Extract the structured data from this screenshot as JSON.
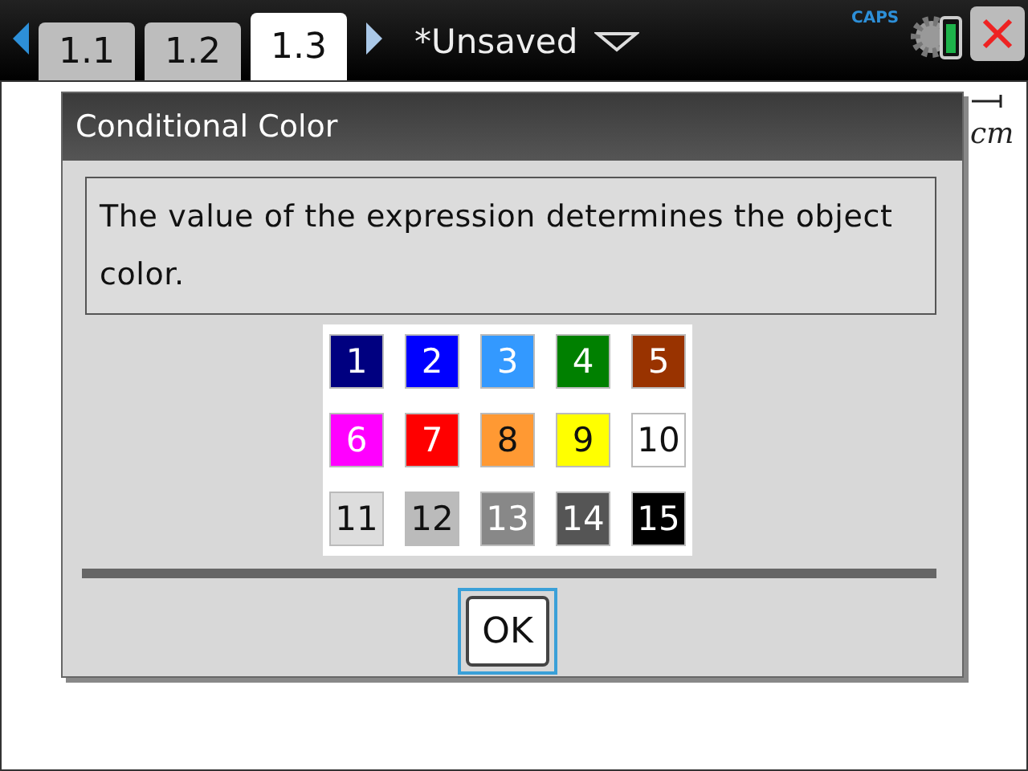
{
  "tabs": [
    {
      "label": "1.1",
      "selected": false
    },
    {
      "label": "1.2",
      "selected": false
    },
    {
      "label": "1.3",
      "selected": true
    }
  ],
  "document": {
    "title": "*Unsaved"
  },
  "status": {
    "caps": "CAPS"
  },
  "page": {
    "unit_label": "cm"
  },
  "dialog": {
    "title": "Conditional Color",
    "message": "The value of the expression determines the object color.",
    "swatches": [
      {
        "label": "1",
        "color": "#000080"
      },
      {
        "label": "2",
        "color": "#0000ff"
      },
      {
        "label": "3",
        "color": "#3399ff"
      },
      {
        "label": "4",
        "color": "#008000"
      },
      {
        "label": "5",
        "color": "#993300"
      },
      {
        "label": "6",
        "color": "#ff00ff"
      },
      {
        "label": "7",
        "color": "#ff0000"
      },
      {
        "label": "8",
        "color": "#ff9933"
      },
      {
        "label": "9",
        "color": "#ffff00"
      },
      {
        "label": "10",
        "color": "#ffffff"
      },
      {
        "label": "11",
        "color": "#dddddd"
      },
      {
        "label": "12",
        "color": "#bbbbbb"
      },
      {
        "label": "13",
        "color": "#888888"
      },
      {
        "label": "14",
        "color": "#555555"
      },
      {
        "label": "15",
        "color": "#000000"
      }
    ],
    "ok_button": "OK"
  }
}
